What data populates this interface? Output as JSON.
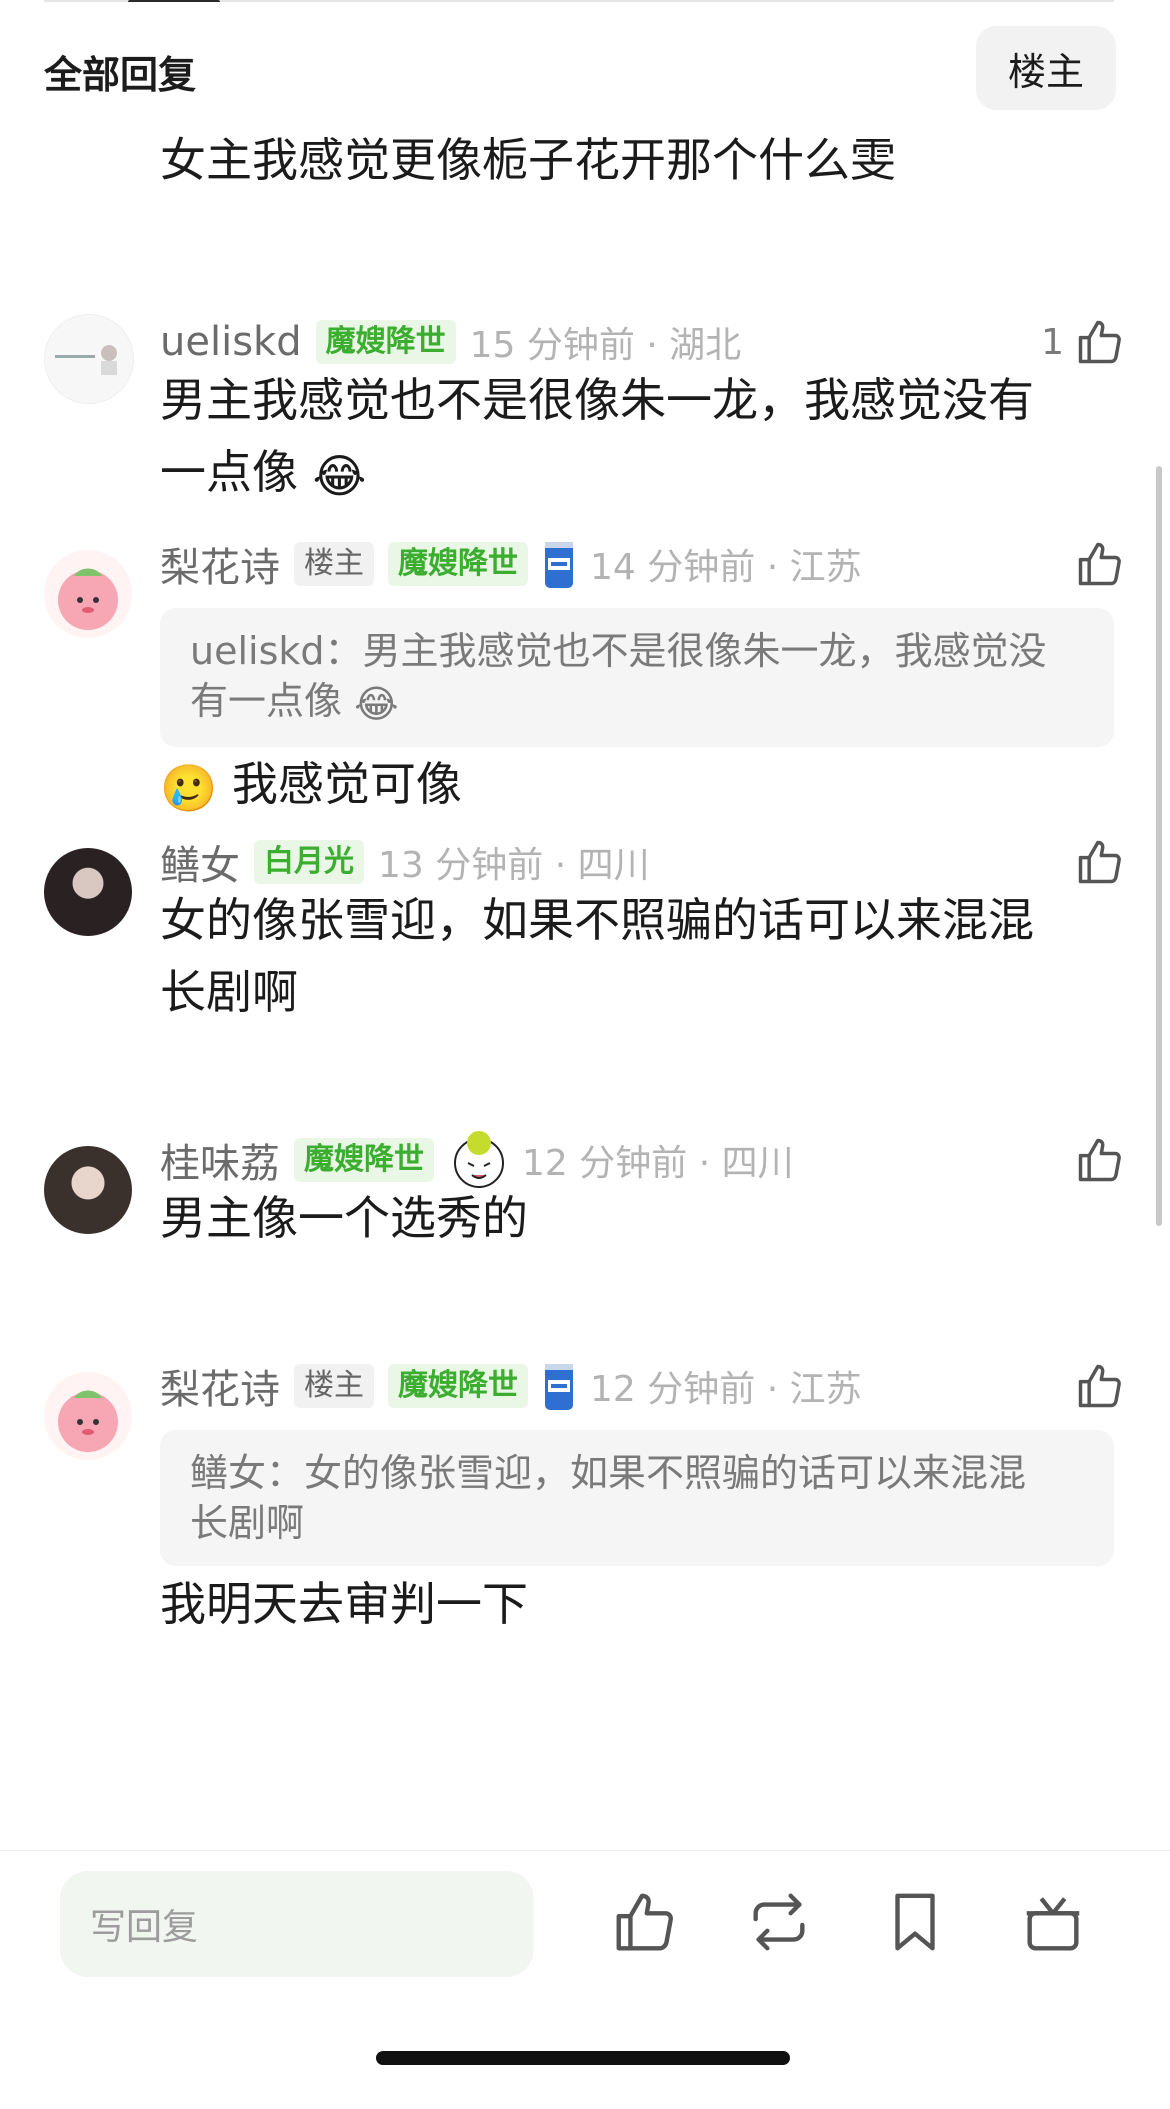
{
  "header": {
    "title": "全部回复",
    "owner_filter": "楼主"
  },
  "partial_comment": {
    "text": "女主我感觉更像栀子花开那个什么雯"
  },
  "comments": [
    {
      "username": "ueliskd",
      "badge": "魔嫂降世",
      "time": "15 分钟前 · 湖北",
      "likes": "1",
      "text_lines": [
        "男主我感觉也不是很像朱一龙，我感觉没有",
        "一点像"
      ],
      "emoji": "😂"
    },
    {
      "username": "梨花诗",
      "owner_tag": "楼主",
      "badge": "魔嫂降世",
      "time": "14 分钟前 · 江苏",
      "quote_lines": [
        "ueliskd：男主我感觉也不是很像朱一龙，我感觉没",
        "有一点像"
      ],
      "quote_emoji": "😂",
      "lead_emoji": "🥲",
      "text": "我感觉可像"
    },
    {
      "username": "鳝女",
      "badge": "白月光",
      "time": "13 分钟前 · 四川",
      "text_lines": [
        "女的像张雪迎，如果不照骗的话可以来混混",
        "长剧啊"
      ]
    },
    {
      "username": "桂味荔",
      "badge": "魔嫂降世",
      "time": "12 分钟前 · 四川",
      "text": "男主像一个选秀的"
    },
    {
      "username": "梨花诗",
      "owner_tag": "楼主",
      "badge": "魔嫂降世",
      "time": "12 分钟前 · 江苏",
      "quote_lines": [
        "鳝女：女的像张雪迎，如果不照骗的话可以来混混",
        "长剧啊"
      ],
      "text": "我明天去审判一下"
    }
  ],
  "bottom_bar": {
    "reply_placeholder": "写回复"
  },
  "colors": {
    "badge_green": "#3cae2f",
    "badge_bg": "#eaf7e6",
    "input_bg": "#f1f6f0"
  },
  "icons": [
    "thumbs-up-icon",
    "repost-icon",
    "bookmark-icon",
    "gift-icon",
    "beer-can-icon",
    "tiger-sticker-icon"
  ]
}
